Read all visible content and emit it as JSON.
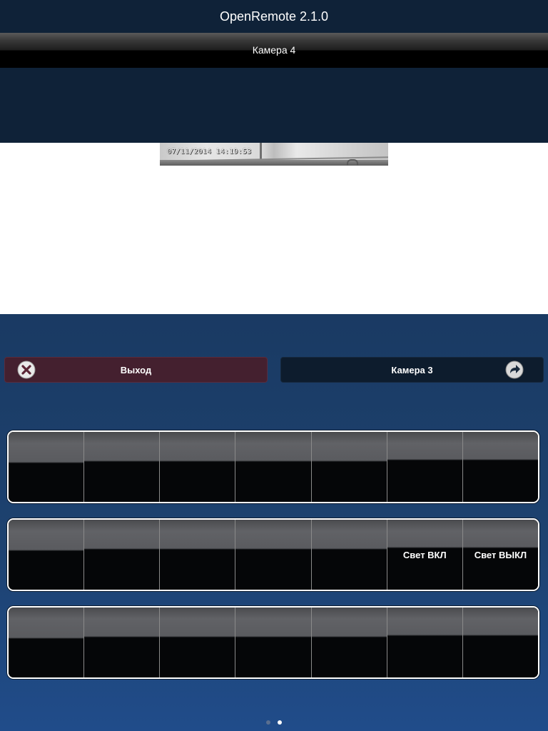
{
  "app": {
    "title": "OpenRemote 2.1.0"
  },
  "nav": {
    "title": "Камера 4"
  },
  "camera": {
    "timestamp": "07/11/2014   14:19:53"
  },
  "buttons": {
    "exit": {
      "label": "Выход",
      "icon": "close-circle-icon",
      "color": "#44202f"
    },
    "camera3": {
      "label": "Камера 3",
      "icon": "redo-arrow-icon",
      "color": "#0d1c2d"
    }
  },
  "panels": [
    {
      "cells": [
        "",
        "",
        "",
        "",
        "",
        "",
        ""
      ]
    },
    {
      "cells": [
        "",
        "",
        "",
        "",
        "",
        "Свет ВКЛ",
        "Свет ВЫКЛ"
      ]
    },
    {
      "cells": [
        "",
        "",
        "",
        "",
        "",
        "",
        ""
      ]
    }
  ],
  "pager": {
    "pages": 2,
    "active": 2
  }
}
